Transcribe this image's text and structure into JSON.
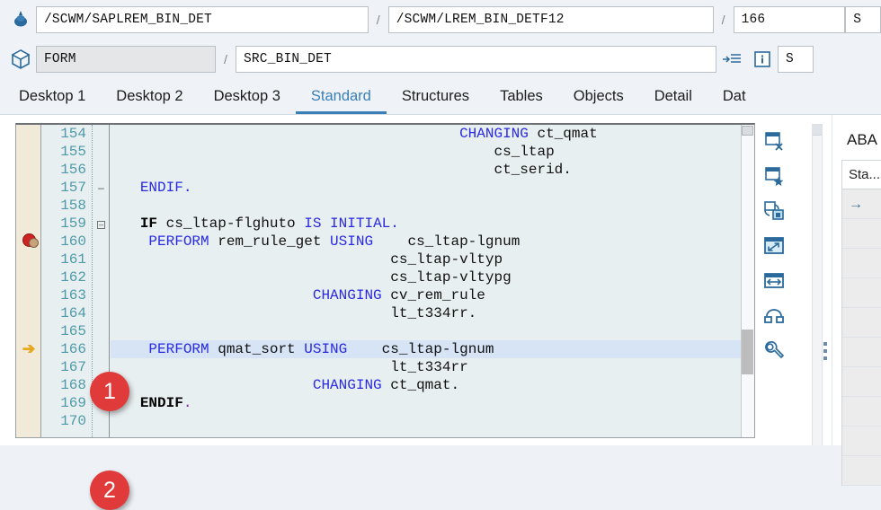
{
  "header": {
    "row1": {
      "icon": "program-tree-icon",
      "program": "/SCWM/SAPLREM_BIN_DET",
      "include": "/SCWM/LREM_BIN_DETF12",
      "line": "166",
      "tail": "S",
      "sep": "/"
    },
    "row2": {
      "icon": "object-cube-icon",
      "type": "FORM",
      "name": "SRC_BIN_DET",
      "tail": "S",
      "sep": "/",
      "buttons": [
        {
          "name": "indent-list-icon",
          "label": ""
        },
        {
          "name": "info-icon",
          "label": "i"
        }
      ]
    }
  },
  "tabs": [
    {
      "label": "Desktop 1",
      "active": false
    },
    {
      "label": "Desktop 2",
      "active": false
    },
    {
      "label": "Desktop 3",
      "active": false
    },
    {
      "label": "Standard",
      "active": true
    },
    {
      "label": "Structures",
      "active": false
    },
    {
      "label": "Tables",
      "active": false
    },
    {
      "label": "Objects",
      "active": false
    },
    {
      "label": "Detail",
      "active": false
    },
    {
      "label": "Dat",
      "active": false
    }
  ],
  "editor": {
    "lines": [
      {
        "num": "154",
        "marker": "",
        "fold": "",
        "indent": 40,
        "tokens": [
          {
            "t": "CHANGING",
            "c": "kw"
          },
          {
            "t": " ct_qmat",
            "c": ""
          }
        ],
        "highlight": false
      },
      {
        "num": "155",
        "marker": "",
        "fold": "",
        "indent": 44,
        "tokens": [
          {
            "t": "cs_ltap",
            "c": ""
          }
        ],
        "highlight": false
      },
      {
        "num": "156",
        "marker": "",
        "fold": "",
        "indent": 44,
        "tokens": [
          {
            "t": "ct_serid.",
            "c": ""
          }
        ],
        "highlight": false
      },
      {
        "num": "157",
        "marker": "",
        "fold": "-",
        "indent": 3,
        "tokens": [
          {
            "t": "ENDIF.",
            "c": "kw"
          }
        ],
        "highlight": false
      },
      {
        "num": "158",
        "marker": "",
        "fold": "",
        "indent": 0,
        "tokens": [],
        "highlight": false
      },
      {
        "num": "159",
        "marker": "",
        "fold": "+",
        "indent": 3,
        "tokens": [
          {
            "t": "IF",
            "c": "bkw"
          },
          {
            "t": " cs_ltap-flghuto ",
            "c": ""
          },
          {
            "t": "IS INITIAL.",
            "c": "kw"
          }
        ],
        "highlight": false
      },
      {
        "num": "160",
        "marker": "breakpoint",
        "fold": "",
        "indent": 4,
        "tokens": [
          {
            "t": "PERFORM",
            "c": "kw"
          },
          {
            "t": " rem_rule_get ",
            "c": ""
          },
          {
            "t": "USING",
            "c": "kw"
          },
          {
            "t": "    cs_ltap-lgnum",
            "c": ""
          }
        ],
        "highlight": false
      },
      {
        "num": "161",
        "marker": "",
        "fold": "",
        "indent": 32,
        "tokens": [
          {
            "t": "cs_ltap-vltyp",
            "c": ""
          }
        ],
        "highlight": false
      },
      {
        "num": "162",
        "marker": "",
        "fold": "",
        "indent": 32,
        "tokens": [
          {
            "t": "cs_ltap-vltypg",
            "c": ""
          }
        ],
        "highlight": false
      },
      {
        "num": "163",
        "marker": "",
        "fold": "",
        "indent": 23,
        "tokens": [
          {
            "t": "CHANGING",
            "c": "kw"
          },
          {
            "t": " cv_rem_rule",
            "c": ""
          }
        ],
        "highlight": false
      },
      {
        "num": "164",
        "marker": "",
        "fold": "",
        "indent": 32,
        "tokens": [
          {
            "t": "lt_t334rr.",
            "c": ""
          }
        ],
        "highlight": false
      },
      {
        "num": "165",
        "marker": "",
        "fold": "",
        "indent": 0,
        "tokens": [],
        "highlight": false
      },
      {
        "num": "166",
        "marker": "arrow",
        "fold": "",
        "indent": 4,
        "tokens": [
          {
            "t": "PERFORM",
            "c": "kw"
          },
          {
            "t": " qmat_sort ",
            "c": ""
          },
          {
            "t": "USING",
            "c": "kw"
          },
          {
            "t": "    cs_ltap-lgnum",
            "c": ""
          }
        ],
        "highlight": true
      },
      {
        "num": "167",
        "marker": "",
        "fold": "",
        "indent": 32,
        "tokens": [
          {
            "t": "lt_t334rr",
            "c": ""
          }
        ],
        "highlight": false
      },
      {
        "num": "168",
        "marker": "",
        "fold": "",
        "indent": 23,
        "tokens": [
          {
            "t": "CHANGING",
            "c": "kw"
          },
          {
            "t": " ct_qmat.",
            "c": ""
          }
        ],
        "highlight": false
      },
      {
        "num": "169",
        "marker": "",
        "fold": "-",
        "indent": 3,
        "tokens": [
          {
            "t": "ENDIF",
            "c": "bkw"
          },
          {
            "t": ".",
            "c": "pt"
          }
        ],
        "highlight": false
      },
      {
        "num": "170",
        "marker": "",
        "fold": "",
        "indent": 0,
        "tokens": [],
        "highlight": false
      }
    ]
  },
  "rail": {
    "buttons": [
      {
        "name": "close-window-icon"
      },
      {
        "name": "favorite-window-icon"
      },
      {
        "name": "restore-layout-icon"
      },
      {
        "name": "resize-diagonal-icon"
      },
      {
        "name": "resize-horizontal-icon"
      },
      {
        "name": "group-windows-icon"
      },
      {
        "name": "wrench-settings-icon"
      }
    ]
  },
  "right_panel": {
    "title": "ABA",
    "column_header": "Sta...",
    "rows": [
      {
        "value": "→"
      },
      {
        "value": ""
      },
      {
        "value": ""
      },
      {
        "value": ""
      },
      {
        "value": ""
      },
      {
        "value": ""
      },
      {
        "value": ""
      },
      {
        "value": ""
      },
      {
        "value": ""
      },
      {
        "value": ""
      }
    ]
  },
  "annotations": [
    {
      "label": "1"
    },
    {
      "label": "2"
    }
  ],
  "colors": {
    "accent": "#3a7fb5",
    "keyword": "#2a2ae0",
    "badge": "#e03a3a",
    "line_number": "#4e9aa8",
    "editor_bg": "#e8eff0",
    "gutter_bg": "#f2ead8",
    "highlight": "#d6e4f5"
  }
}
